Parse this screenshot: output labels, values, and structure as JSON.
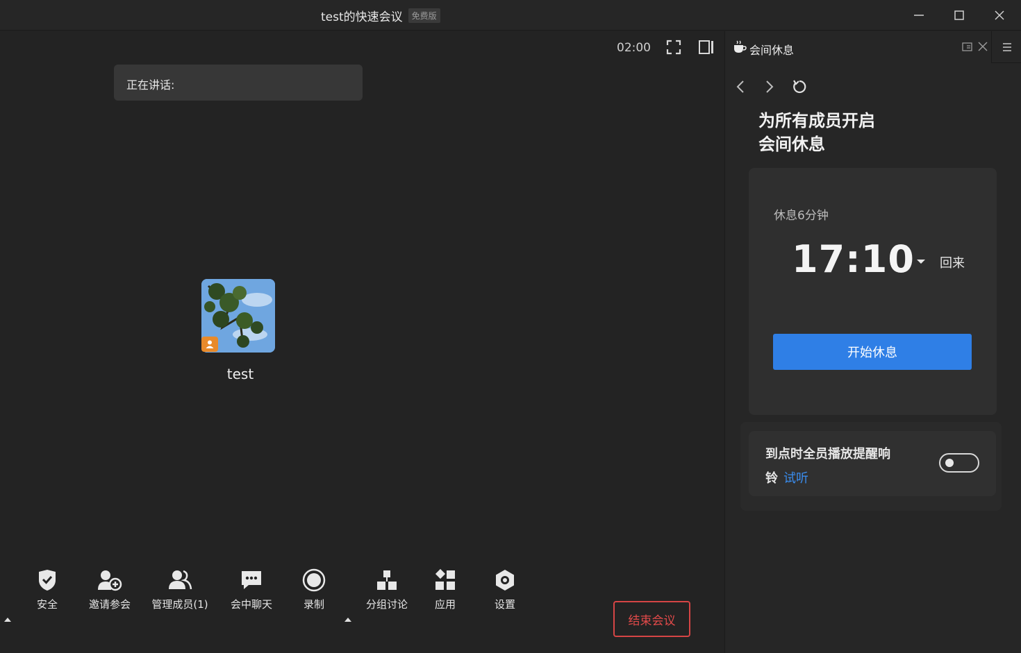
{
  "window": {
    "title": "test的快速会议",
    "badge": "免费版"
  },
  "stage": {
    "timer": "02:00",
    "speaking_label": "正在讲话:",
    "participant_name": "test"
  },
  "toolbar": {
    "items": [
      {
        "label": "安全",
        "icon": "shield-check-icon"
      },
      {
        "label": "邀请参会",
        "icon": "invite-user-icon"
      },
      {
        "label": "管理成员(1)",
        "icon": "members-icon"
      },
      {
        "label": "会中聊天",
        "icon": "chat-icon"
      },
      {
        "label": "录制",
        "icon": "record-icon"
      },
      {
        "label": "分组讨论",
        "icon": "breakout-icon"
      },
      {
        "label": "应用",
        "icon": "apps-icon"
      },
      {
        "label": "设置",
        "icon": "settings-icon"
      }
    ],
    "end_meeting": "结束会议"
  },
  "panel": {
    "title": "会间休息",
    "headline_line1": "为所有成员开启",
    "headline_line2": "会间休息",
    "break_label": "休息6分钟",
    "break_time": "17:10",
    "return_label": "回来",
    "start_button": "开始休息",
    "reminder_text_1": "到点时全员播放提醒响",
    "reminder_text_2": "铃",
    "reminder_link": "试听",
    "reminder_enabled": false
  },
  "colors": {
    "accent": "#2f7fe6",
    "danger": "#d64545",
    "link": "#3a8ef0",
    "badge": "#e88a2a"
  }
}
